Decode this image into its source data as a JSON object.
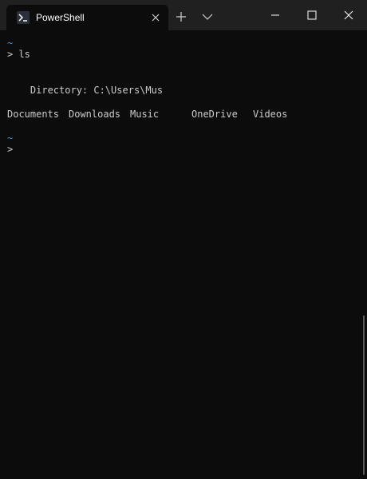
{
  "tab": {
    "title": "PowerShell",
    "icon": "powershell-icon"
  },
  "titlebar": {
    "new_tab_icon": "plus-icon",
    "dropdown_icon": "chevron-down-icon",
    "minimize_icon": "minimize-icon",
    "maximize_icon": "maximize-icon",
    "close_icon": "close-icon"
  },
  "terminal": {
    "prompt1_path": "~",
    "prompt1_cmd": "> ls",
    "directory_line": "    Directory: C:\\Users\\Mus",
    "entries": [
      "Documents",
      "Downloads",
      "Music",
      "OneDrive",
      "Videos"
    ],
    "prompt2_path": "~",
    "prompt2_cmd": ">"
  },
  "colors": {
    "background": "#0c0c0c",
    "titlebar": "#202020",
    "text": "#cccccc",
    "path": "#3a96dd"
  }
}
